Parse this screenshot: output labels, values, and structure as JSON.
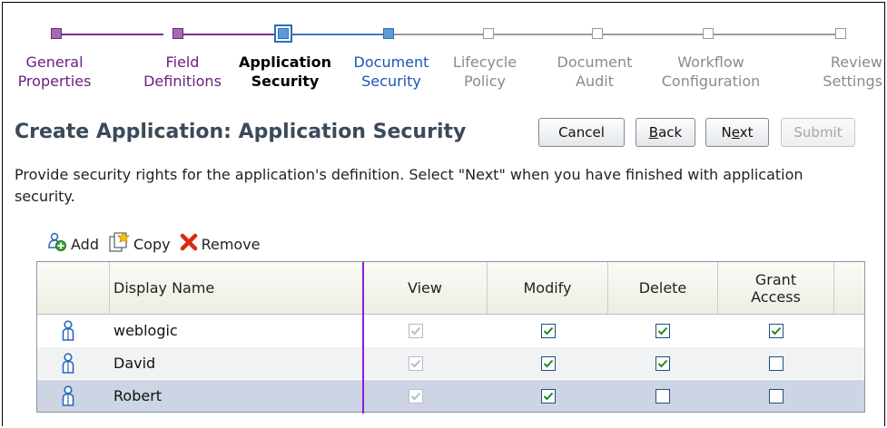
{
  "train": {
    "stops": [
      {
        "line1": "General",
        "line2": "Properties",
        "state": "visited"
      },
      {
        "line1": "Field",
        "line2": "Definitions",
        "state": "visited"
      },
      {
        "line1": "Application",
        "line2": "Security",
        "state": "current"
      },
      {
        "line1": "Document",
        "line2": "Security",
        "state": "next"
      },
      {
        "line1": "Lifecycle",
        "line2": "Policy",
        "state": "future"
      },
      {
        "line1": "Document",
        "line2": "Audit",
        "state": "future"
      },
      {
        "line1": "Workflow",
        "line2": "Configuration",
        "state": "future"
      },
      {
        "line1": "Review",
        "line2": "Settings",
        "state": "future"
      }
    ],
    "colors": {
      "visited": "#7b2e8f",
      "current": "#2a6fb8",
      "next": "#3c78c8",
      "future": "#9a9a9a"
    }
  },
  "page": {
    "title": "Create Application: Application Security",
    "description": "Provide security rights for the application's definition. Select \"Next\" when you have finished with application security."
  },
  "buttons": {
    "cancel": "Cancel",
    "back": "Back",
    "next": "Next",
    "submit": "Submit"
  },
  "toolbar": {
    "add": "Add",
    "copy": "Copy",
    "remove": "Remove"
  },
  "table": {
    "headers": {
      "display_name": "Display Name",
      "view": "View",
      "modify": "Modify",
      "delete": "Delete",
      "grant_access": "Grant Access"
    },
    "rows": [
      {
        "name": "weblogic",
        "view": true,
        "modify": true,
        "delete": true,
        "grant": true
      },
      {
        "name": "David",
        "view": true,
        "modify": true,
        "delete": true,
        "grant": false
      },
      {
        "name": "Robert",
        "view": true,
        "modify": true,
        "delete": false,
        "grant": false
      }
    ],
    "selected_row_index": 2
  }
}
